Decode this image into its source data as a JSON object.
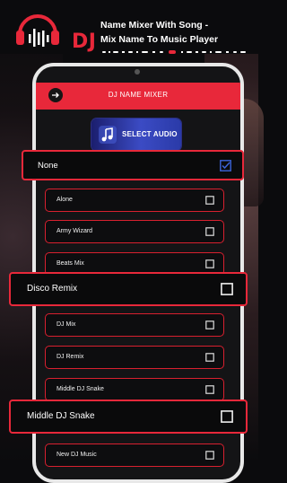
{
  "header": {
    "logo_text": "DJ",
    "title_line1": "Name Mixer With Song -",
    "title_line2": "Mix Name To Music Player"
  },
  "app": {
    "title": "DJ NAME MIXER",
    "select_audio_label": "SELECT AUDIO"
  },
  "items": {
    "none": "None",
    "alone": "Alone",
    "army_wizard": "Army Wizard",
    "beats_mix": "Beats Mix",
    "disco_remix": "Disco Remix",
    "dj_mix": "DJ Mix",
    "dj_remix": "DJ Remix",
    "middle_dj_snake_small": "Middle DJ Snake",
    "middle_dj_snake_big": "Middle DJ Snake",
    "new_dj_music": "New DJ Music"
  },
  "selected_item": "None",
  "colors": {
    "accent": "#e8283a",
    "background": "#0b0b0d",
    "check_selected": "#3b63d8"
  }
}
